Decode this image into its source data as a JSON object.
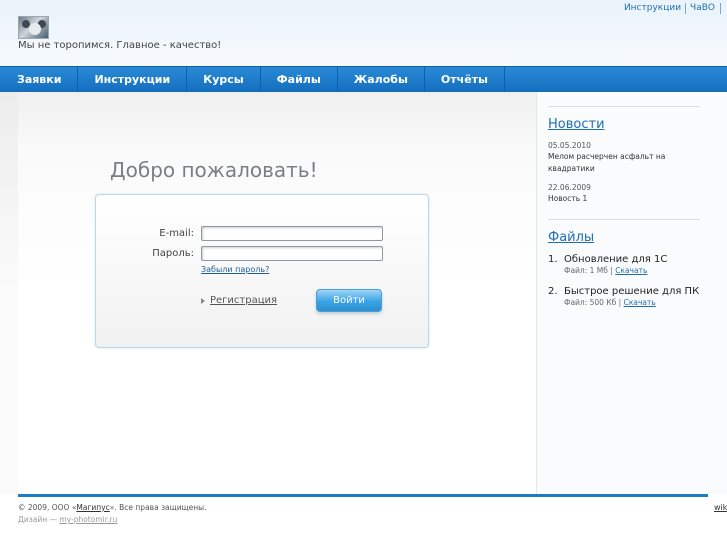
{
  "header": {
    "slogan": "Мы не торопимся. Главное - качество!",
    "top_links": [
      "Инструкции",
      "ЧаВО"
    ]
  },
  "nav": {
    "items": [
      "Заявки",
      "Инструкции",
      "Курсы",
      "Файлы",
      "Жалобы",
      "Отчёты"
    ]
  },
  "login": {
    "welcome": "Добро пожаловать!",
    "email_label": "E-mail:",
    "email_value": "",
    "password_label": "Пароль:",
    "password_value": "",
    "forgot_label": "Забыли пароль?",
    "register_label": "Регистрация",
    "submit_label": "Войти"
  },
  "sidebar": {
    "news_title": "Новости",
    "news": [
      {
        "date": "05.05.2010",
        "text": "Мелом расчерчен асфальт на квадратики"
      },
      {
        "date": "22.06.2009",
        "text": "Новость 1"
      }
    ],
    "files_title": "Файлы",
    "files": [
      {
        "num": "1.",
        "name": "Обновление для 1С",
        "size": "Файл: 1 Мб |",
        "download": "Скачать"
      },
      {
        "num": "2.",
        "name": "Быстрое решение для ПК",
        "size": "Файл: 500 Кб |",
        "download": "Скачать"
      }
    ]
  },
  "footer": {
    "copyright_pre": "© 2009, ООО «",
    "company": "Магипус",
    "copyright_post": "». Все права защищены.",
    "design_pre": "Дизайн — ",
    "design_link": "my-photomir.ru",
    "wiki": "wik"
  }
}
